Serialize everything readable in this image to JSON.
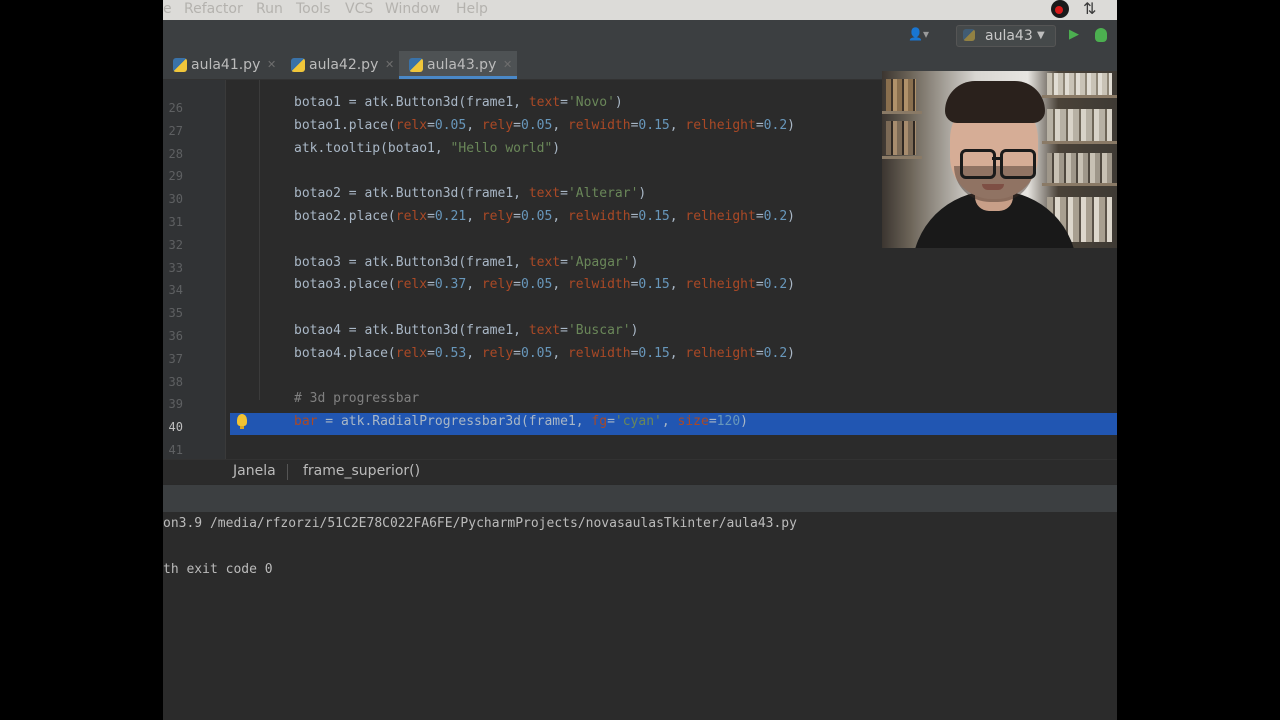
{
  "menubar": {
    "items": [
      "e",
      "Refactor",
      "Run",
      "Tools",
      "VCS",
      "Window",
      "Help"
    ]
  },
  "navbar": {
    "run_config": "aula43"
  },
  "tabs": [
    {
      "label": "aula41.py"
    },
    {
      "label": "aula42.py"
    },
    {
      "label": "aula43.py",
      "active": true
    }
  ],
  "editor": {
    "line_numbers": [
      "26",
      "27",
      "28",
      "29",
      "30",
      "31",
      "32",
      "33",
      "34",
      "35",
      "36",
      "37",
      "38",
      "39",
      "40",
      "41"
    ],
    "current_line": "40",
    "lines": [
      [
        {
          "t": "botao1 = atk.Button3d(frame1, "
        },
        {
          "t": "text",
          "c": "param"
        },
        {
          "t": "="
        },
        {
          "t": "'Novo'",
          "c": "str"
        },
        {
          "t": ")"
        }
      ],
      [
        {
          "t": "botao1.place("
        },
        {
          "t": "relx",
          "c": "param"
        },
        {
          "t": "="
        },
        {
          "t": "0.05",
          "c": "num"
        },
        {
          "t": ", "
        },
        {
          "t": "rely",
          "c": "param"
        },
        {
          "t": "="
        },
        {
          "t": "0.05",
          "c": "num"
        },
        {
          "t": ", "
        },
        {
          "t": "relwidth",
          "c": "param"
        },
        {
          "t": "="
        },
        {
          "t": "0.15",
          "c": "num"
        },
        {
          "t": ", "
        },
        {
          "t": "relheight",
          "c": "param"
        },
        {
          "t": "="
        },
        {
          "t": "0.2",
          "c": "num"
        },
        {
          "t": ")"
        }
      ],
      [
        {
          "t": "atk.tooltip(botao1, "
        },
        {
          "t": "\"Hello world\"",
          "c": "str"
        },
        {
          "t": ")"
        }
      ],
      [],
      [
        {
          "t": "botao2 = atk.Button3d(frame1, "
        },
        {
          "t": "text",
          "c": "param"
        },
        {
          "t": "="
        },
        {
          "t": "'Alterar'",
          "c": "str"
        },
        {
          "t": ")"
        }
      ],
      [
        {
          "t": "botao2.place("
        },
        {
          "t": "relx",
          "c": "param"
        },
        {
          "t": "="
        },
        {
          "t": "0.21",
          "c": "num"
        },
        {
          "t": ", "
        },
        {
          "t": "rely",
          "c": "param"
        },
        {
          "t": "="
        },
        {
          "t": "0.05",
          "c": "num"
        },
        {
          "t": ", "
        },
        {
          "t": "relwidth",
          "c": "param"
        },
        {
          "t": "="
        },
        {
          "t": "0.15",
          "c": "num"
        },
        {
          "t": ", "
        },
        {
          "t": "relheight",
          "c": "param"
        },
        {
          "t": "="
        },
        {
          "t": "0.2",
          "c": "num"
        },
        {
          "t": ")"
        }
      ],
      [],
      [
        {
          "t": "botao3 = atk.Button3d(frame1, "
        },
        {
          "t": "text",
          "c": "param"
        },
        {
          "t": "="
        },
        {
          "t": "'Apagar'",
          "c": "str"
        },
        {
          "t": ")"
        }
      ],
      [
        {
          "t": "botao3.place("
        },
        {
          "t": "relx",
          "c": "param"
        },
        {
          "t": "="
        },
        {
          "t": "0.37",
          "c": "num"
        },
        {
          "t": ", "
        },
        {
          "t": "rely",
          "c": "param"
        },
        {
          "t": "="
        },
        {
          "t": "0.05",
          "c": "num"
        },
        {
          "t": ", "
        },
        {
          "t": "relwidth",
          "c": "param"
        },
        {
          "t": "="
        },
        {
          "t": "0.15",
          "c": "num"
        },
        {
          "t": ", "
        },
        {
          "t": "relheight",
          "c": "param"
        },
        {
          "t": "="
        },
        {
          "t": "0.2",
          "c": "num"
        },
        {
          "t": ")"
        }
      ],
      [],
      [
        {
          "t": "botao4 = atk.Button3d(frame1, "
        },
        {
          "t": "text",
          "c": "param"
        },
        {
          "t": "="
        },
        {
          "t": "'Buscar'",
          "c": "str"
        },
        {
          "t": ")"
        }
      ],
      [
        {
          "t": "botao4.place("
        },
        {
          "t": "relx",
          "c": "param"
        },
        {
          "t": "="
        },
        {
          "t": "0.53",
          "c": "num"
        },
        {
          "t": ", "
        },
        {
          "t": "rely",
          "c": "param"
        },
        {
          "t": "="
        },
        {
          "t": "0.05",
          "c": "num"
        },
        {
          "t": ", "
        },
        {
          "t": "relwidth",
          "c": "param"
        },
        {
          "t": "="
        },
        {
          "t": "0.15",
          "c": "num"
        },
        {
          "t": ", "
        },
        {
          "t": "relheight",
          "c": "param"
        },
        {
          "t": "="
        },
        {
          "t": "0.2",
          "c": "num"
        },
        {
          "t": ")"
        }
      ],
      [],
      [
        {
          "t": "# 3d progressbar",
          "c": "cmt"
        }
      ],
      [
        {
          "t": "bar",
          "c": "param"
        },
        {
          "t": " = atk.RadialProgressbar3d(frame1, "
        },
        {
          "t": "fg",
          "c": "param"
        },
        {
          "t": "="
        },
        {
          "t": "'cyan'",
          "c": "str"
        },
        {
          "t": ", "
        },
        {
          "t": "size",
          "c": "param"
        },
        {
          "t": "="
        },
        {
          "t": "120",
          "c": "num"
        },
        {
          "t": ")"
        }
      ],
      []
    ]
  },
  "breadcrumb": {
    "items": [
      "Janela",
      "frame_superior()"
    ]
  },
  "console": {
    "lines": [
      "on3.9 /media/rfzorzi/51C2E78C022FA6FE/PycharmProjects/novasaulasTkinter/aula43.py",
      "",
      "th exit code 0"
    ]
  },
  "colors": {
    "selection": "#2156b2",
    "background": "#2b2b2b",
    "param": "#aa4926",
    "number": "#6897bb",
    "string": "#6a8759",
    "comment": "#808080"
  }
}
